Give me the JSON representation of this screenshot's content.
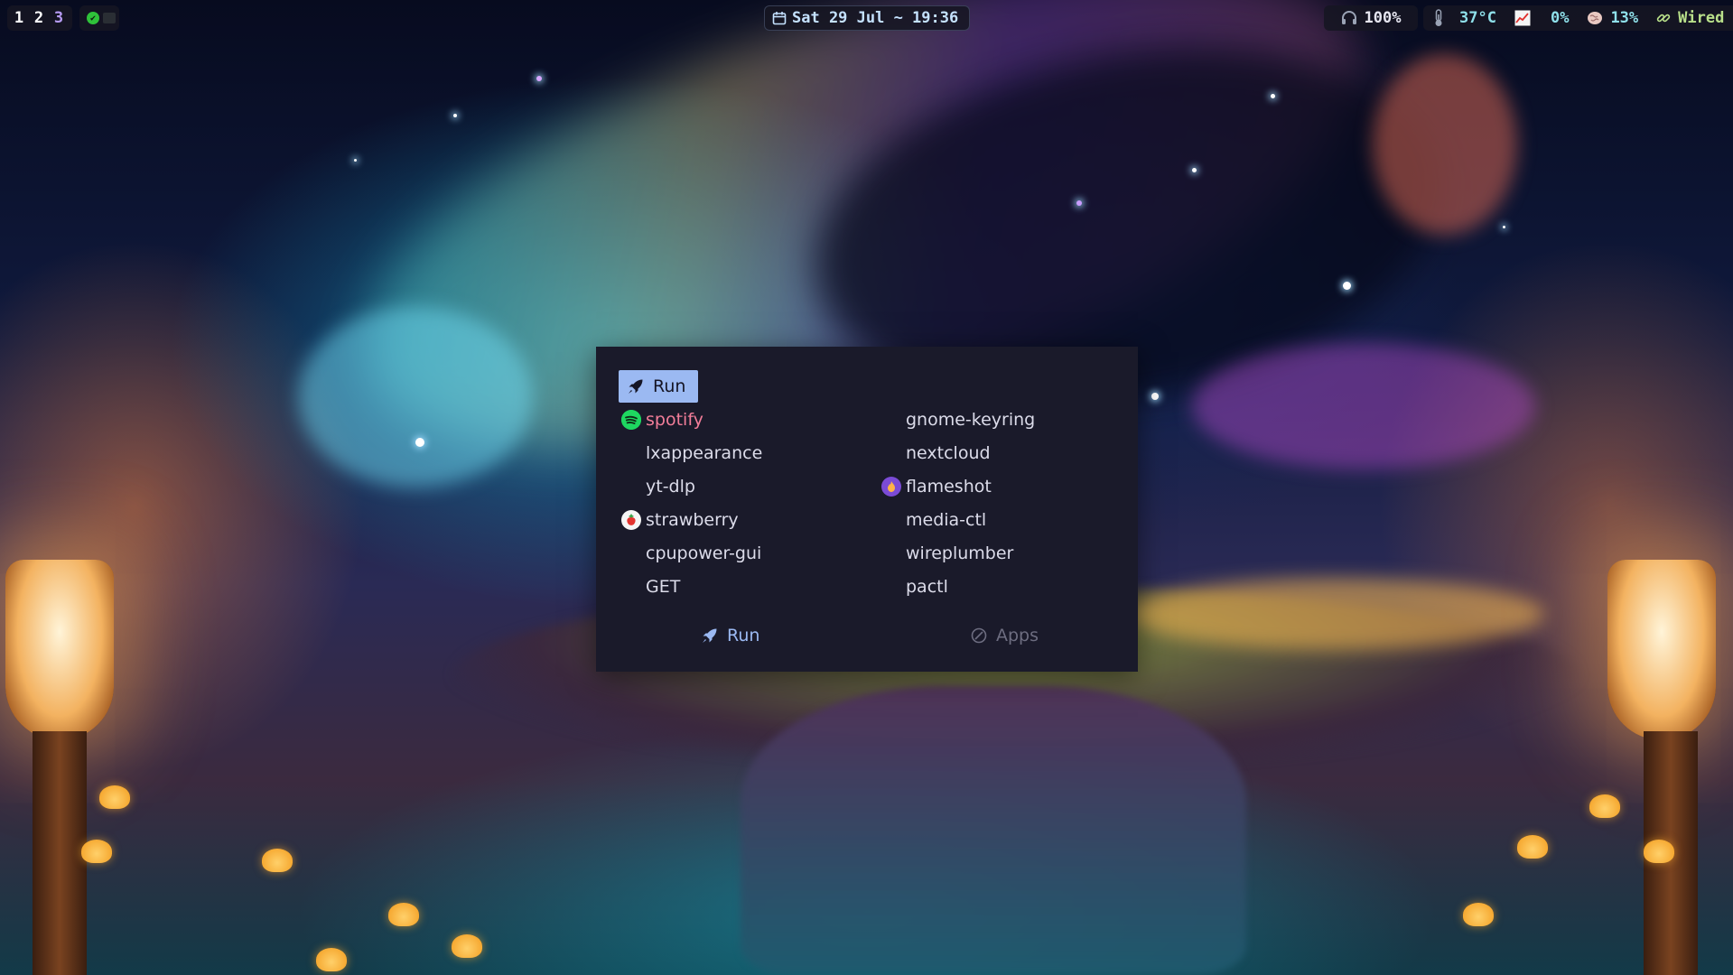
{
  "topbar": {
    "workspaces": [
      "1",
      "2",
      "3"
    ],
    "clock": {
      "text": "Sat 29 Jul ~ 19:36",
      "icon": "calendar-icon"
    },
    "status": {
      "volume": "100%",
      "temperature": "37°C",
      "cpu": "0%",
      "memory": "13%",
      "network": "Wired"
    },
    "tray_indicator": "status-check-icon"
  },
  "launcher": {
    "mode_label": "Run",
    "entries_left": [
      {
        "label": "spotify",
        "icon": "spotify-icon"
      },
      {
        "label": "lxappearance"
      },
      {
        "label": "yt-dlp"
      },
      {
        "label": "strawberry",
        "icon": "strawberry-icon"
      },
      {
        "label": "cpupower-gui"
      },
      {
        "label": "GET"
      }
    ],
    "entries_right": [
      {
        "label": "gnome-keyring"
      },
      {
        "label": "nextcloud"
      },
      {
        "label": "flameshot",
        "icon": "flameshot-icon"
      },
      {
        "label": "media-ctl"
      },
      {
        "label": "wireplumber"
      },
      {
        "label": "pactl"
      }
    ],
    "selected": "spotify",
    "footer": {
      "run": "Run",
      "apps": "Apps"
    }
  },
  "colors": {
    "launcher_bg": "#1a1a2a",
    "badge_bg": "#9bb9f2",
    "selected_text": "#f27d99",
    "bar_bg": "#161622",
    "workspace_focused": "#b79cf5"
  }
}
